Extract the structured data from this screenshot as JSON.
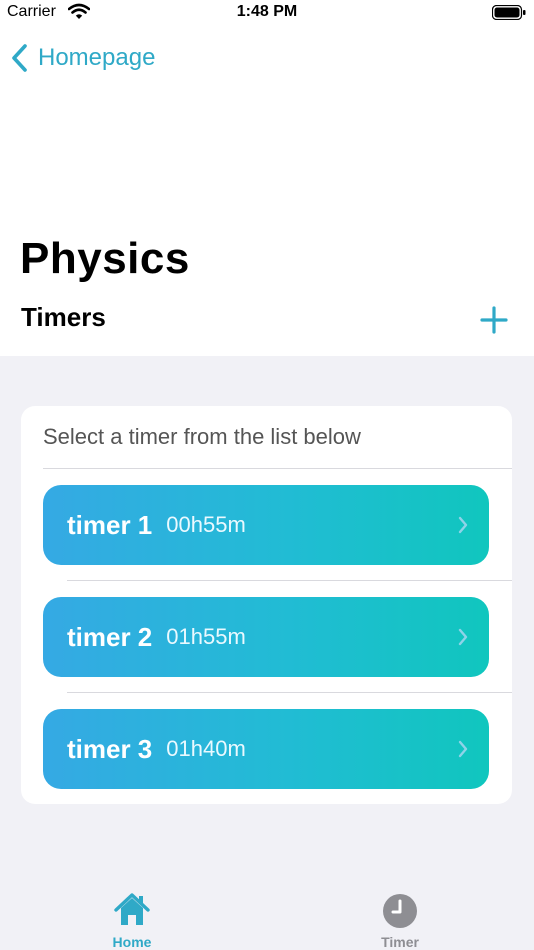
{
  "status_bar": {
    "carrier": "Carrier",
    "time": "1:48 PM",
    "wifi_icon": "wifi-icon",
    "battery_icon": "battery-icon"
  },
  "nav": {
    "back_label": "Homepage",
    "back_icon": "chevron-left-icon"
  },
  "page": {
    "title": "Physics",
    "section_title": "Timers",
    "add_icon": "plus-icon"
  },
  "card": {
    "hint": "Select a timer from the list below",
    "timers": [
      {
        "name": "timer 1",
        "duration": "00h55m"
      },
      {
        "name": "timer 2",
        "duration": "01h55m"
      },
      {
        "name": "timer 3",
        "duration": "01h40m"
      }
    ]
  },
  "tab_bar": {
    "tabs": [
      {
        "label": "Home",
        "icon": "home-icon",
        "selected": true
      },
      {
        "label": "Timer",
        "icon": "clock-icon",
        "selected": false
      }
    ]
  },
  "colors": {
    "accent": "#2fa9c7",
    "gradient_start": "#35a9e4",
    "gradient_end": "#10c6be",
    "background": "#f1f1f6"
  }
}
